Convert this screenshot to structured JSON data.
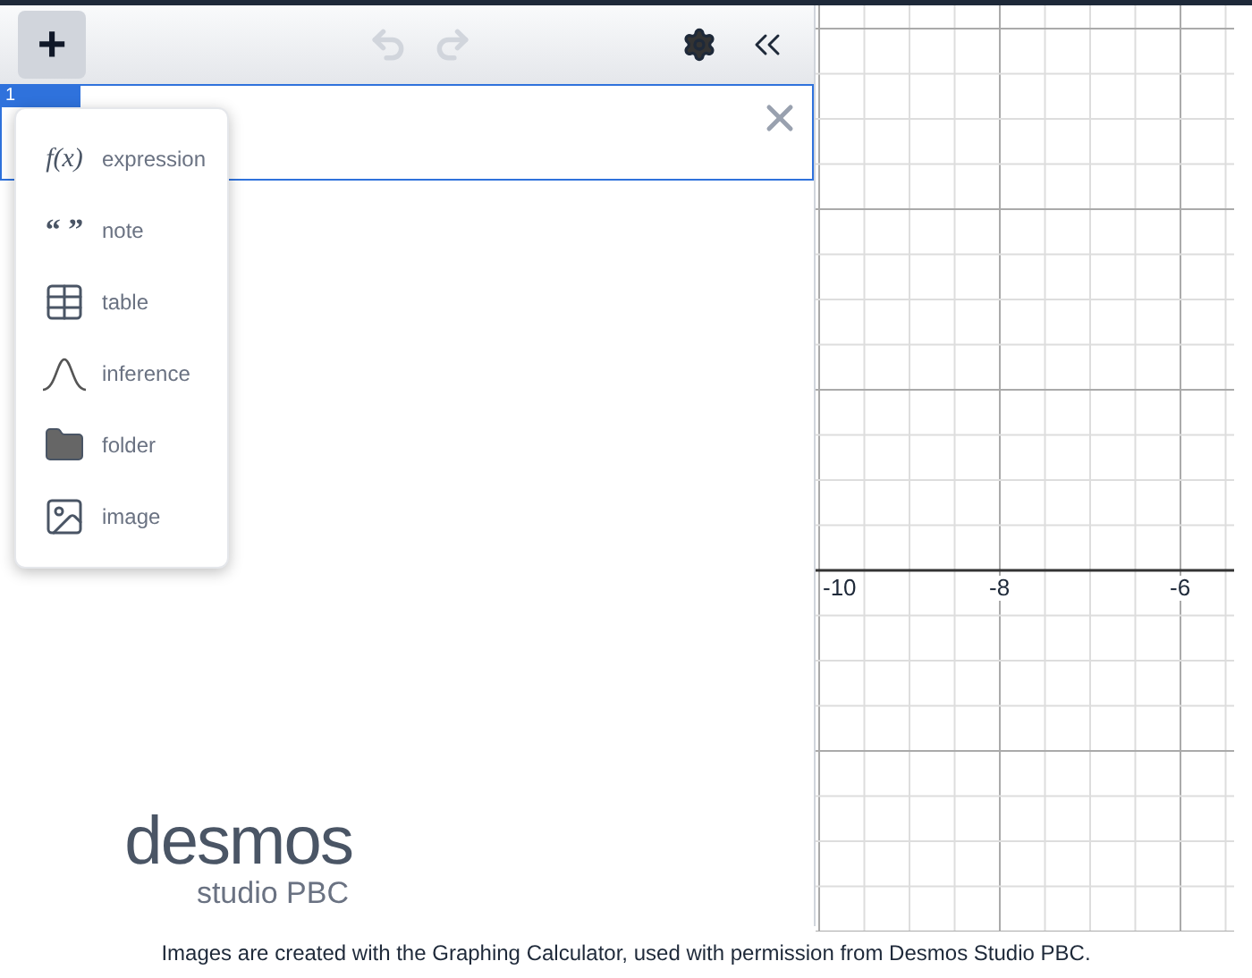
{
  "toolbar": {
    "add_button": "+"
  },
  "expression_list": [
    {
      "index": "1"
    }
  ],
  "add_menu": {
    "items": [
      {
        "kind": "expression",
        "icon_text": "f(x)",
        "label": "expression"
      },
      {
        "kind": "note",
        "icon_text": "“ ”",
        "label": "note"
      },
      {
        "kind": "table",
        "label": "table"
      },
      {
        "kind": "inference",
        "label": "inference"
      },
      {
        "kind": "folder",
        "label": "folder"
      },
      {
        "kind": "image",
        "label": "image"
      }
    ]
  },
  "logo": {
    "name": "desmos",
    "subtitle": "studio PBC"
  },
  "graph": {
    "x_tick_labels": [
      "-10",
      "-8",
      "-6"
    ]
  },
  "caption": "Images are created with the Graphing Calculator, used with permission from Desmos Studio PBC."
}
